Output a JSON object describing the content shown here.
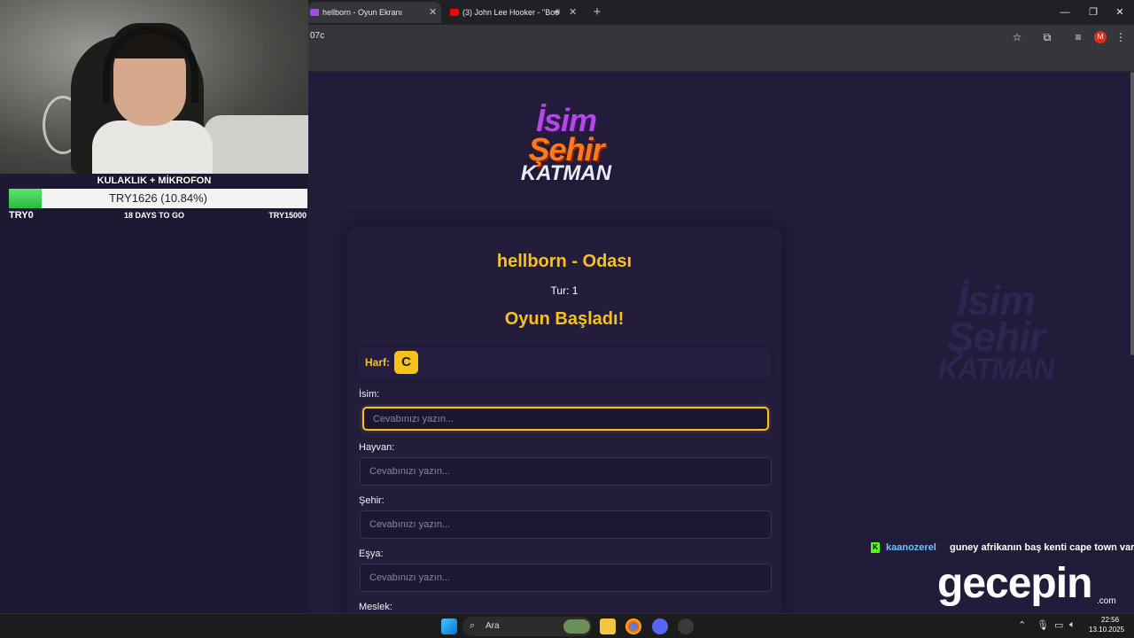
{
  "overlay": {
    "goal_title": "KULAKLIK + MİKROFON",
    "goal_amount": "TRY1626 (10.84%)",
    "goal_progress_percent": 10.84,
    "goal_min": "TRY0",
    "goal_days": "18 DAYS TO GO",
    "goal_max": "TRY15000"
  },
  "browser": {
    "tabs": [
      {
        "title": "hellborn - Oyun Ekranı",
        "active": true
      },
      {
        "title": "(3) John Lee Hooker - \"Boo",
        "active": false
      }
    ],
    "url_fragment": "07c"
  },
  "game": {
    "logo": {
      "line1": "İsim",
      "line2": "Şehir",
      "line3": "KATMAN"
    },
    "watermark": {
      "line1": "İsim",
      "line2": "Şehir",
      "line3": "KATMAN"
    },
    "room_title": "hellborn - Odası",
    "round": "Tur: 1",
    "status": "Oyun Başladı!",
    "letter_label": "Harf:",
    "letter": "C",
    "fields": [
      {
        "label": "İsim:",
        "placeholder": "Cevabınızı yazın..."
      },
      {
        "label": "Hayvan:",
        "placeholder": "Cevabınızı yazın..."
      },
      {
        "label": "Şehir:",
        "placeholder": "Cevabınızı yazın..."
      },
      {
        "label": "Eşya:",
        "placeholder": "Cevabınızı yazın..."
      },
      {
        "label": "Meslek:"
      }
    ]
  },
  "chat": {
    "badge": "K",
    "user": "kaanozerel",
    "message": "guney afrikanın baş kenti cape town var"
  },
  "brand": {
    "name": "gecepin",
    "sub": ".com"
  },
  "taskbar": {
    "search_text": "Ara",
    "time": "22:56",
    "date": "13.10.2025"
  },
  "colors": {
    "accent": "#f6c21b",
    "page_bg": "#221b3a",
    "card_bg": "#231c3b",
    "goal_fill": "#2db83e"
  }
}
